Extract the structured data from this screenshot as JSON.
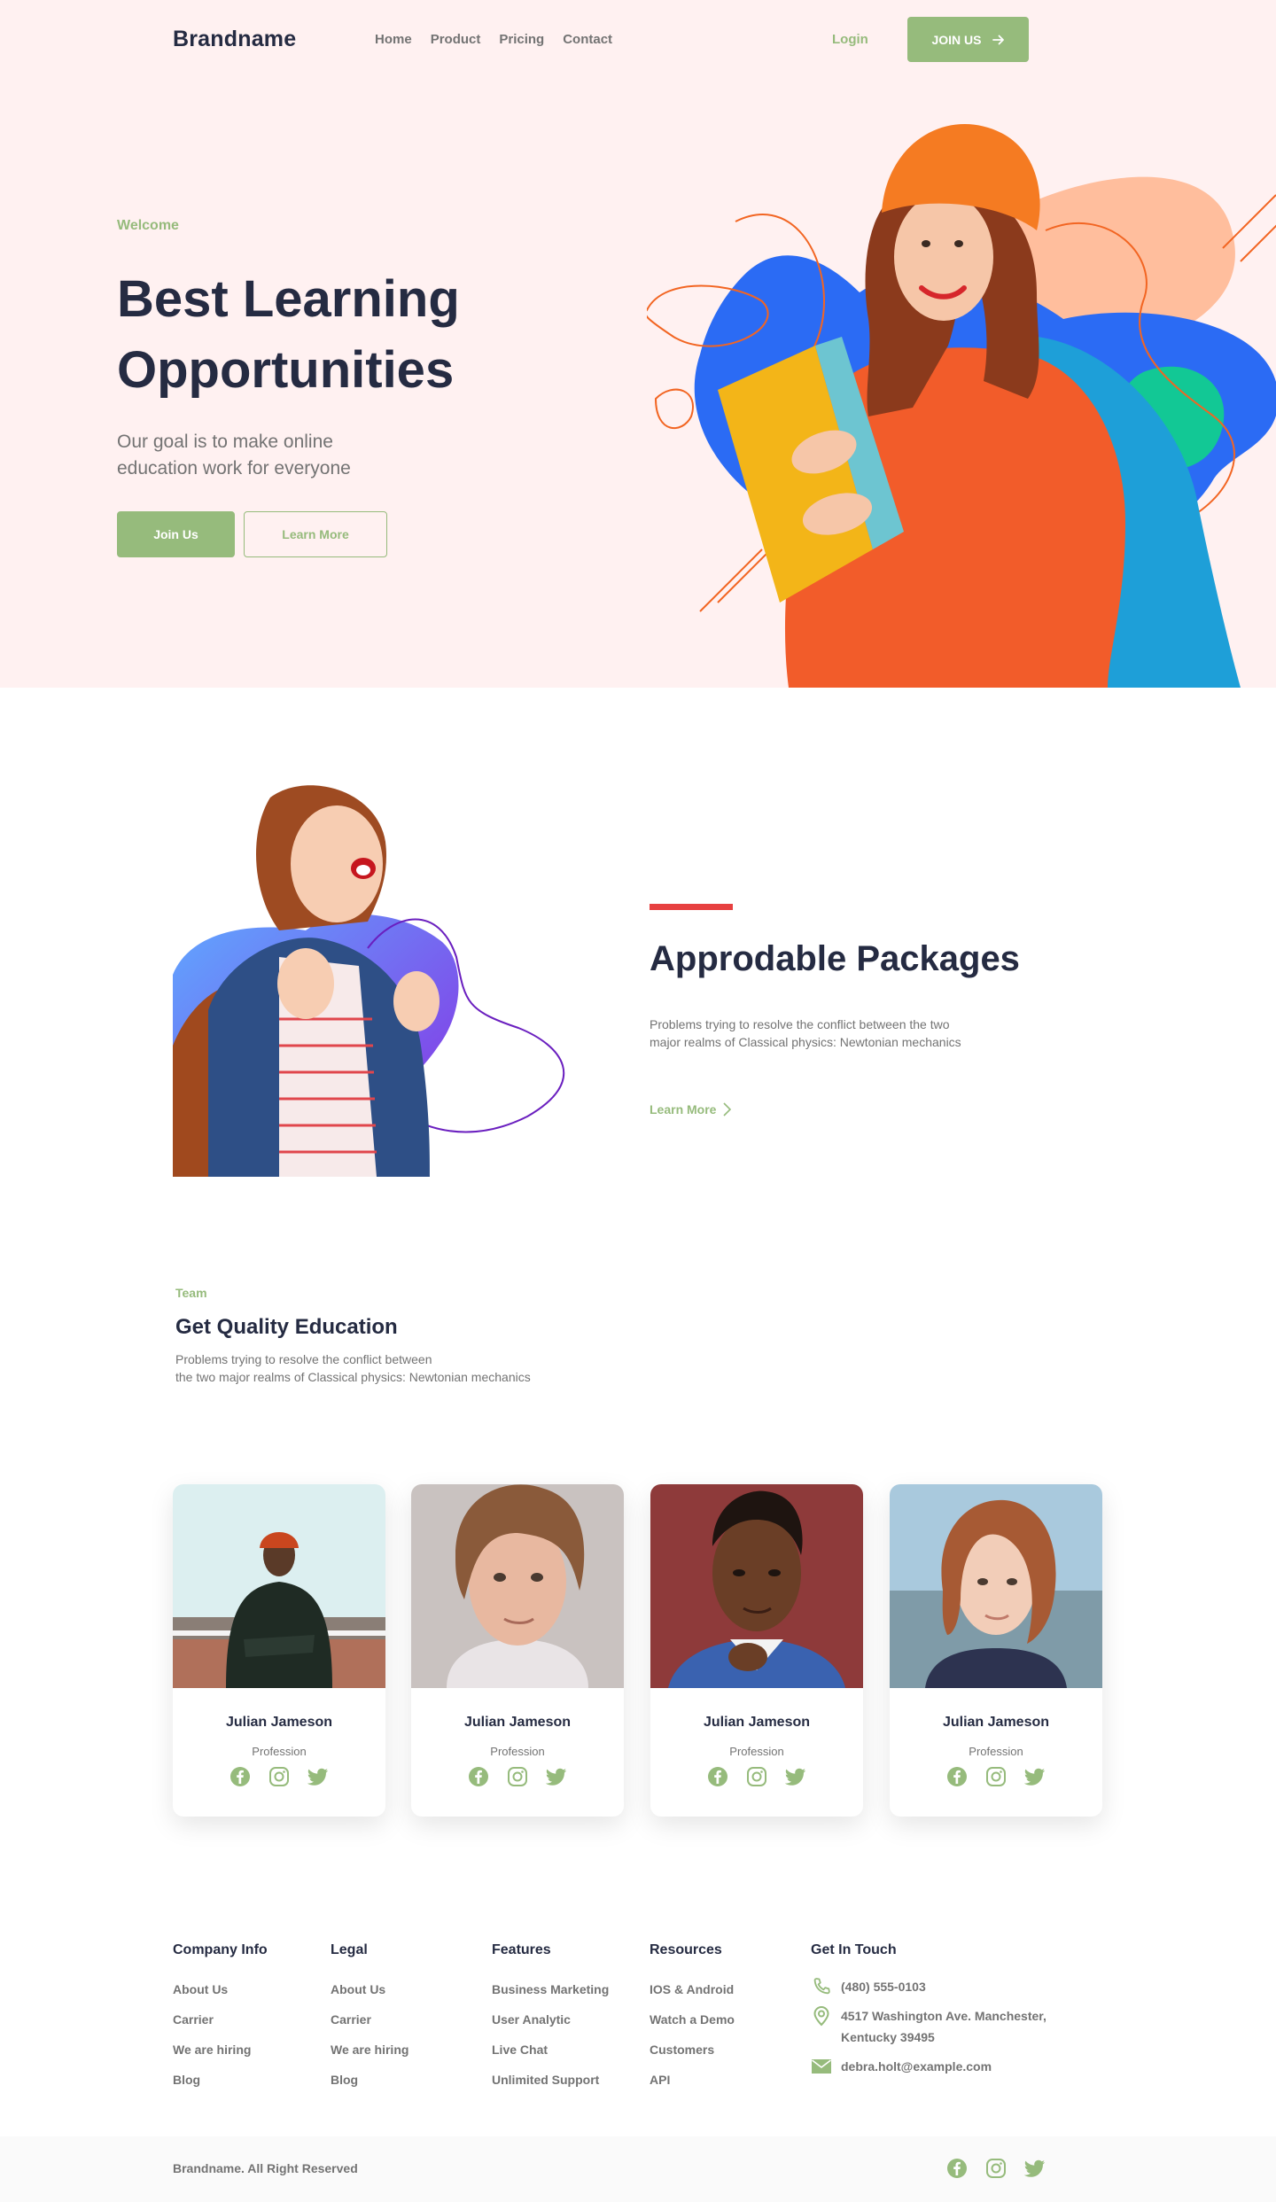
{
  "nav": {
    "brand": "Brandname",
    "links": [
      "Home",
      "Product",
      "Pricing",
      "Contact"
    ],
    "login": "Login",
    "join": "JOIN US"
  },
  "hero": {
    "eyebrow": "Welcome",
    "title": "Best Learning Opportunities",
    "subtitle": "Our goal is to make online education work for everyone",
    "primary_button": "Join Us",
    "secondary_button": "Learn More"
  },
  "packages": {
    "title": "Approdable Packages",
    "description": "Problems trying to resolve the conflict between the two major realms of Classical physics: Newtonian mechanics",
    "link": "Learn More"
  },
  "team": {
    "tag": "Team",
    "title": "Get Quality Education",
    "description_line1": "Problems trying to resolve the conflict between",
    "description_line2": "the two major realms of Classical physics: Newtonian mechanics",
    "members": [
      {
        "name": "Julian Jameson",
        "profession": "Profession"
      },
      {
        "name": "Julian Jameson",
        "profession": "Profession"
      },
      {
        "name": "Julian Jameson",
        "profession": "Profession"
      },
      {
        "name": "Julian Jameson",
        "profession": "Profession"
      }
    ]
  },
  "footer": {
    "columns": [
      {
        "title": "Company Info",
        "links": [
          "About Us",
          "Carrier",
          "We are hiring",
          "Blog"
        ]
      },
      {
        "title": "Legal",
        "links": [
          "About Us",
          "Carrier",
          "We are hiring",
          "Blog"
        ]
      },
      {
        "title": "Features",
        "links": [
          "Business Marketing",
          "User Analytic",
          "Live Chat",
          "Unlimited Support"
        ]
      },
      {
        "title": "Resources",
        "links": [
          "IOS & Android",
          "Watch a Demo",
          "Customers",
          "API"
        ]
      }
    ],
    "contact": {
      "title": "Get In Touch",
      "phone": "(480) 555-0103",
      "address": "4517 Washington Ave. Manchester, Kentucky 39495",
      "email": "debra.holt@example.com"
    },
    "copyright": "Brandname. All Right Reserved"
  },
  "colors": {
    "accent": "#96BB7C",
    "heading": "#252B42",
    "muted": "#737373",
    "hero_bg": "#FFF1F1",
    "red": "#E74040"
  }
}
